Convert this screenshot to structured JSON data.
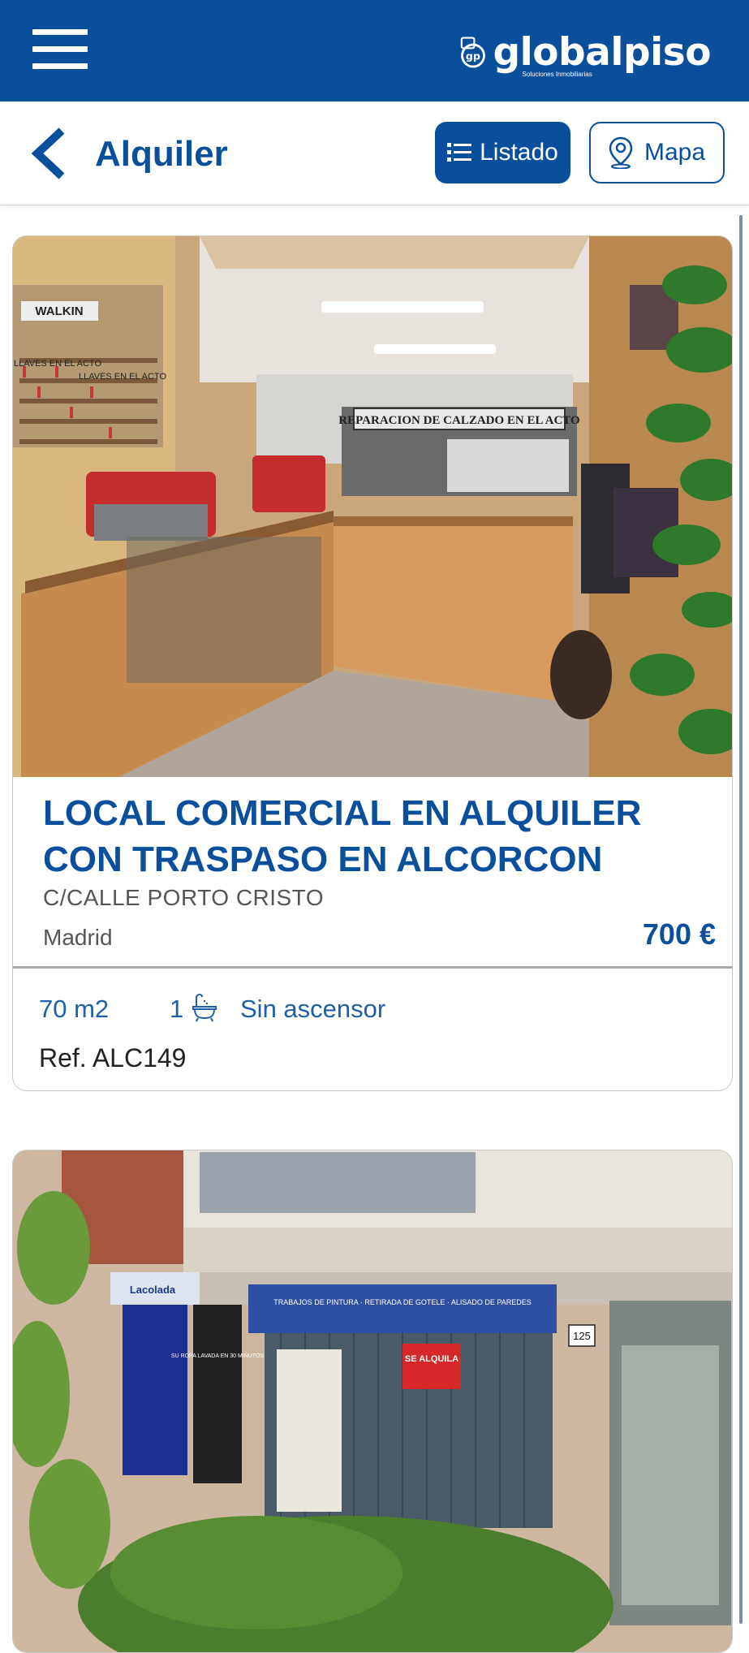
{
  "header": {
    "brand": "globalpiso",
    "tagline": "Soluciones Inmobiliarias",
    "logo_initials": "gp"
  },
  "subheader": {
    "title": "Alquiler",
    "listado_label": "Listado",
    "mapa_label": "Mapa"
  },
  "listings": [
    {
      "title": "LOCAL COMERCIAL EN ALQUILER CON TRASPASO EN ALCORCON",
      "street": "C/CALLE PORTO CRISTO",
      "city": "Madrid",
      "price": "700 €",
      "area": "70 m2",
      "baths": "1",
      "elevator": "Sin ascensor",
      "ref": "Ref. ALC149",
      "photo_signs": [
        "REPARACION DE CALZADO EN EL ACTO",
        "WALKIN",
        "LLAVES EN EL ACTO",
        "LLAVES EN EL ACTO"
      ]
    },
    {
      "photo_signs": [
        "SE ALQUILA",
        "125",
        "Lacolada",
        "SU ROPA LAVADA EN 30 MINUTOS",
        "TRABAJOS DE PINTURA · RETIRADA DE GOTELE · ALISADO DE PAREDES"
      ]
    }
  ],
  "colors": {
    "brand_blue": "#0a4f9c",
    "text_grey": "#555555"
  },
  "icons": {
    "menu": "hamburger-icon",
    "back": "chevron-left-icon",
    "list": "list-icon",
    "map": "map-pin-icon",
    "bath": "bathtub-icon"
  }
}
